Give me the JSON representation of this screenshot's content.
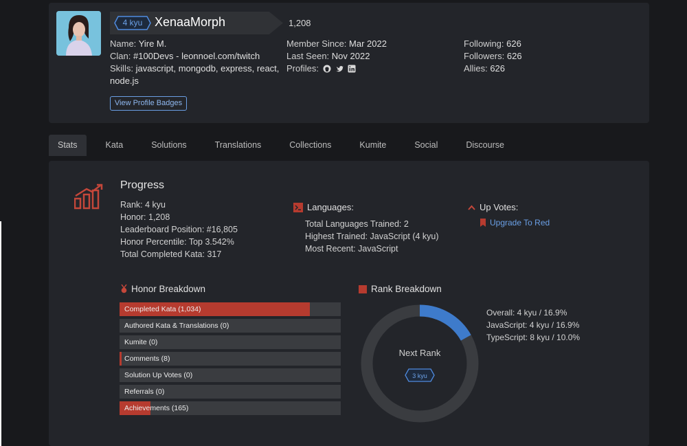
{
  "profile": {
    "rank_badge": "4 kyu",
    "username": "XenaaMorph",
    "honor": "1,208",
    "col1": [
      {
        "key": "Name:",
        "value": "Yire M."
      },
      {
        "key": "Clan:",
        "value": "#100Devs - leonnoel.com/twitch"
      },
      {
        "key": "Skills:",
        "value": "javascript, mongodb, express, react,"
      },
      {
        "key": "",
        "value": "node.js"
      }
    ],
    "col2": [
      {
        "key": "Member Since:",
        "value": "Mar 2022"
      },
      {
        "key": "Last Seen:",
        "value": "Nov 2022"
      },
      {
        "key": "Profiles:",
        "value": ""
      }
    ],
    "col3": [
      {
        "key": "Following:",
        "value": "626"
      },
      {
        "key": "Followers:",
        "value": "626"
      },
      {
        "key": "Allies:",
        "value": "626"
      }
    ],
    "profile_icons": [
      "github-icon",
      "twitter-icon",
      "linkedin-icon"
    ],
    "badges_button": "View Profile Badges"
  },
  "tabs": [
    "Stats",
    "Kata",
    "Solutions",
    "Translations",
    "Collections",
    "Kumite",
    "Social",
    "Discourse"
  ],
  "progress": {
    "title": "Progress",
    "stats": [
      "Rank: 4 kyu",
      "Honor: 1,208",
      "Leaderboard Position: #16,805",
      "Honor Percentile: Top 3.542%",
      "Total Completed Kata: 317"
    ]
  },
  "languages": {
    "title": "Languages:",
    "items": [
      "Total Languages Trained: 2",
      "Highest Trained: JavaScript (4 kyu)",
      "Most Recent: JavaScript"
    ]
  },
  "upvotes": {
    "title": "Up Votes:",
    "link": "Upgrade To Red"
  },
  "honor_breakdown": {
    "title": "Honor Breakdown",
    "items": [
      {
        "label": "Completed Kata (1,034)",
        "fill": 0.86
      },
      {
        "label": "Authored Kata & Translations (0)",
        "fill": 0
      },
      {
        "label": "Kumite (0)",
        "fill": 0
      },
      {
        "label": "Comments (8)",
        "fill": 0.01
      },
      {
        "label": "Solution Up Votes (0)",
        "fill": 0
      },
      {
        "label": "Referrals (0)",
        "fill": 0
      },
      {
        "label": "Achievements (165)",
        "fill": 0.14
      }
    ]
  },
  "rank_breakdown": {
    "title": "Rank Breakdown",
    "center_label": "Next Rank",
    "next_rank_badge": "3 kyu",
    "progress_fraction": 0.169,
    "items": [
      "Overall: 4 kyu / 16.9%",
      "JavaScript: 4 kyu / 16.9%",
      "TypeScript: 8 kyu / 10.0%"
    ]
  },
  "colors": {
    "accent_red": "#b63b2f",
    "accent_blue": "#6ba0e6",
    "panel": "#23252a",
    "background": "#18191c"
  }
}
